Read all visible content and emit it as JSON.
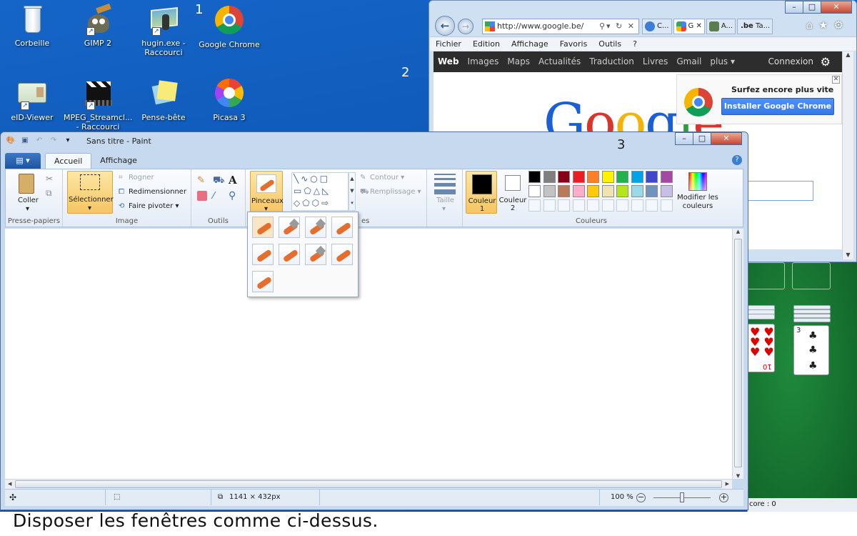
{
  "desktop": {
    "icons": [
      {
        "label": "Corbeille"
      },
      {
        "label": "GIMP 2"
      },
      {
        "label": "hugin.exe - Raccourci"
      },
      {
        "label": "Google Chrome"
      },
      {
        "label": "eID-Viewer"
      },
      {
        "label": "MPEG_Streamcl... - Raccourci"
      },
      {
        "label": "Pense-bête"
      },
      {
        "label": "Picasa 3"
      }
    ],
    "numbers": [
      "1",
      "2",
      "3"
    ]
  },
  "ie": {
    "address": "http://www.google.be/",
    "tabs": [
      "C...",
      "G",
      "A...",
      "Ta..."
    ],
    "tab_domain_prefix": ".be",
    "menu": [
      "Fichier",
      "Edition",
      "Affichage",
      "Favoris",
      "Outils",
      "?"
    ],
    "google_bar": [
      "Web",
      "Images",
      "Maps",
      "Actualités",
      "Traduction",
      "Livres",
      "Gmail",
      "plus ▾"
    ],
    "login": "Connexion",
    "promo_text": "Surfez encore plus vite",
    "promo_button": "Installer Google Chrome",
    "logo_text": "Google"
  },
  "paint": {
    "title": "Sans titre - Paint",
    "tabs": {
      "file": "▤ ▾",
      "home": "Accueil",
      "view": "Affichage"
    },
    "clipboard": {
      "paste": "Coller",
      "group": "Presse-papiers"
    },
    "image": {
      "select": "Sélectionner",
      "crop": "Rogner",
      "resize": "Redimensionner",
      "rotate": "Faire pivoter ▾",
      "group": "Image"
    },
    "tools": {
      "group": "Outils"
    },
    "brushes": {
      "label": "Pinceaux"
    },
    "shapes": {
      "outline": "Contour ▾",
      "fill": "Remplissage ▾",
      "group_partial": "es"
    },
    "size": {
      "label": "Taille"
    },
    "colors": {
      "color1": "Couleur 1",
      "color2": "Couleur 2",
      "edit": "Modifier les couleurs",
      "group": "Couleurs"
    },
    "palette_row1": [
      "#000000",
      "#7f7f7f",
      "#880015",
      "#ed1c24",
      "#ff7f27",
      "#fff200",
      "#22b14c",
      "#00a2e8",
      "#3f48cc",
      "#a349a4"
    ],
    "palette_row2": [
      "#ffffff",
      "#c3c3c3",
      "#b97a57",
      "#ffaec9",
      "#ffc90e",
      "#efe4b0",
      "#b5e61d",
      "#99d9ea",
      "#7092be",
      "#c8bfe7"
    ],
    "status": {
      "dimensions": "1141 × 432px",
      "zoom": "100 %"
    }
  },
  "solitaire": {
    "score": "core : 0",
    "card_rank": "3",
    "card_rank_flipped": "10"
  },
  "caption": "Disposer les fenêtres comme ci-dessus."
}
